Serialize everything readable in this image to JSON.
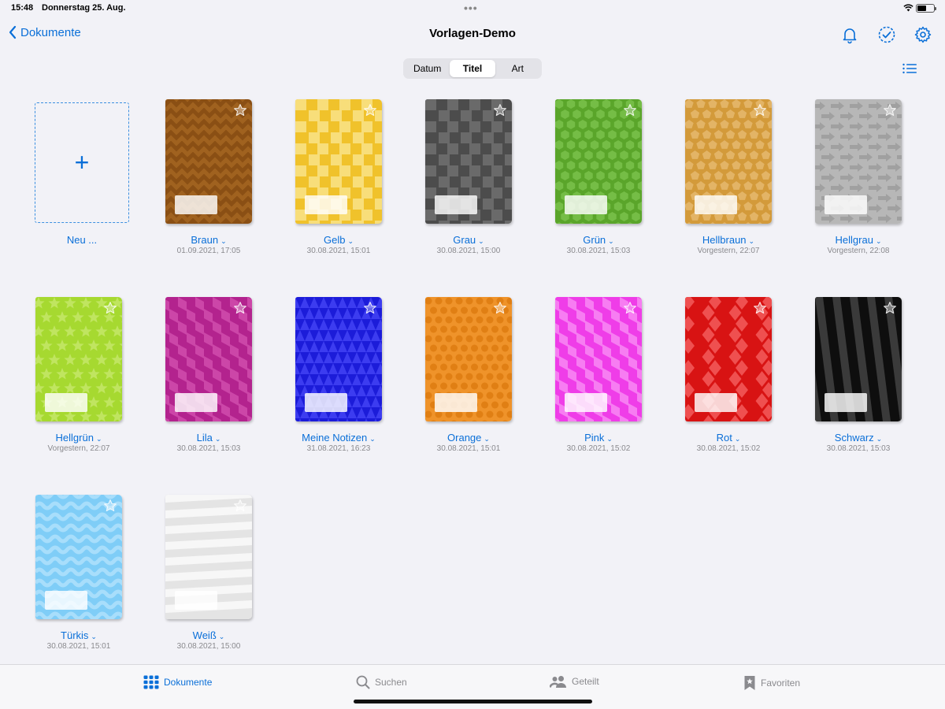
{
  "status": {
    "time": "15:48",
    "date": "Donnerstag 25. Aug.",
    "dots": "•••"
  },
  "nav": {
    "back_label": "Dokumente",
    "title": "Vorlagen-Demo"
  },
  "sort": {
    "options": [
      "Datum",
      "Titel",
      "Art"
    ],
    "selected": "Titel"
  },
  "new_item": {
    "label": "Neu ...",
    "plus": "+"
  },
  "documents": [
    {
      "name": "Braun",
      "date": "01.09.2021, 17:05",
      "color": "#8a4f14",
      "accent": "#a0621f",
      "pattern": "zigzag"
    },
    {
      "name": "Gelb",
      "date": "30.08.2021, 15:01",
      "color": "#f0c22b",
      "accent": "#f8de7a",
      "pattern": "checker"
    },
    {
      "name": "Grau",
      "date": "30.08.2021, 15:00",
      "color": "#4c4c4c",
      "accent": "#6a6a6a",
      "pattern": "checker"
    },
    {
      "name": "Grün",
      "date": "30.08.2021, 15:03",
      "color": "#5aa52a",
      "accent": "#75bd46",
      "pattern": "hex"
    },
    {
      "name": "Hellbraun",
      "date": "Vorgestern, 22:07",
      "color": "#d39a3a",
      "accent": "#e3b466",
      "pattern": "pentagon"
    },
    {
      "name": "Hellgrau",
      "date": "Vorgestern, 22:08",
      "color": "#b7b7b7",
      "accent": "#a0a0a0",
      "pattern": "arrows"
    },
    {
      "name": "Hellgrün",
      "date": "Vorgestern, 22:07",
      "color": "#a6d930",
      "accent": "#c0e560",
      "pattern": "stars"
    },
    {
      "name": "Lila",
      "date": "30.08.2021, 15:03",
      "color": "#b3238e",
      "accent": "#cc46a8",
      "pattern": "cubes"
    },
    {
      "name": "Meine Notizen",
      "date": "31.08.2021, 16:23",
      "color": "#1c1cd9",
      "accent": "#3c3cf0",
      "pattern": "triangles"
    },
    {
      "name": "Orange",
      "date": "30.08.2021, 15:01",
      "color": "#ef932a",
      "accent": "#e07f14",
      "pattern": "dots"
    },
    {
      "name": "Pink",
      "date": "30.08.2021, 15:02",
      "color": "#ef3de8",
      "accent": "#f77df2",
      "pattern": "cubes"
    },
    {
      "name": "Rot",
      "date": "30.08.2021, 15:02",
      "color": "#d81313",
      "accent": "#ef5050",
      "pattern": "diamonds"
    },
    {
      "name": "Schwarz",
      "date": "30.08.2021, 15:03",
      "color": "#0e0e0e",
      "accent": "#3a3a3a",
      "pattern": "stripes"
    },
    {
      "name": "Türkis",
      "date": "30.08.2021, 15:01",
      "color": "#7fcdf7",
      "accent": "#a8defb",
      "pattern": "waves"
    },
    {
      "name": "Weiß",
      "date": "30.08.2021, 15:00",
      "color": "#e4e4e4",
      "accent": "#f7f7f7",
      "pattern": "bands"
    }
  ],
  "tabs": [
    {
      "label": "Dokumente",
      "icon": "grid-icon",
      "active": true
    },
    {
      "label": "Suchen",
      "icon": "search-icon",
      "active": false
    },
    {
      "label": "Geteilt",
      "icon": "people-icon",
      "active": false
    },
    {
      "label": "Favoriten",
      "icon": "bookmark-star-icon",
      "active": false
    }
  ]
}
